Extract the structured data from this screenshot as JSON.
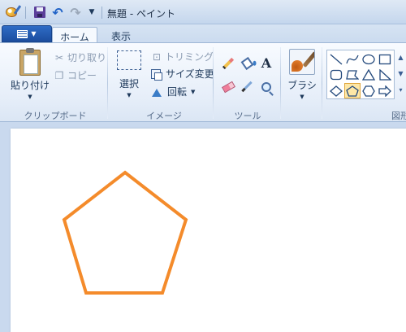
{
  "window": {
    "title": "無題 - ペイント"
  },
  "quick_access": {
    "items": [
      "paint-app-icon",
      "save-icon",
      "undo-icon",
      "redo-icon",
      "customize-dropdown"
    ]
  },
  "tabs": [
    {
      "label": "ホーム",
      "active": true
    },
    {
      "label": "表示",
      "active": false
    }
  ],
  "ribbon": {
    "clipboard": {
      "paste_label": "貼り付け",
      "cut_label": "切り取り",
      "copy_label": "コピー",
      "group_label": "クリップボード"
    },
    "image": {
      "select_label": "選択",
      "crop_label": "トリミング",
      "resize_label": "サイズ変更",
      "rotate_label": "回転",
      "group_label": "イメージ"
    },
    "tools": {
      "text_tool_glyph": "A",
      "group_label": "ツール"
    },
    "brushes": {
      "label": "ブラシ"
    },
    "shapes": {
      "selected": "pentagon",
      "group_label_partial": "図形",
      "outline_color": "#f48b2b"
    }
  }
}
